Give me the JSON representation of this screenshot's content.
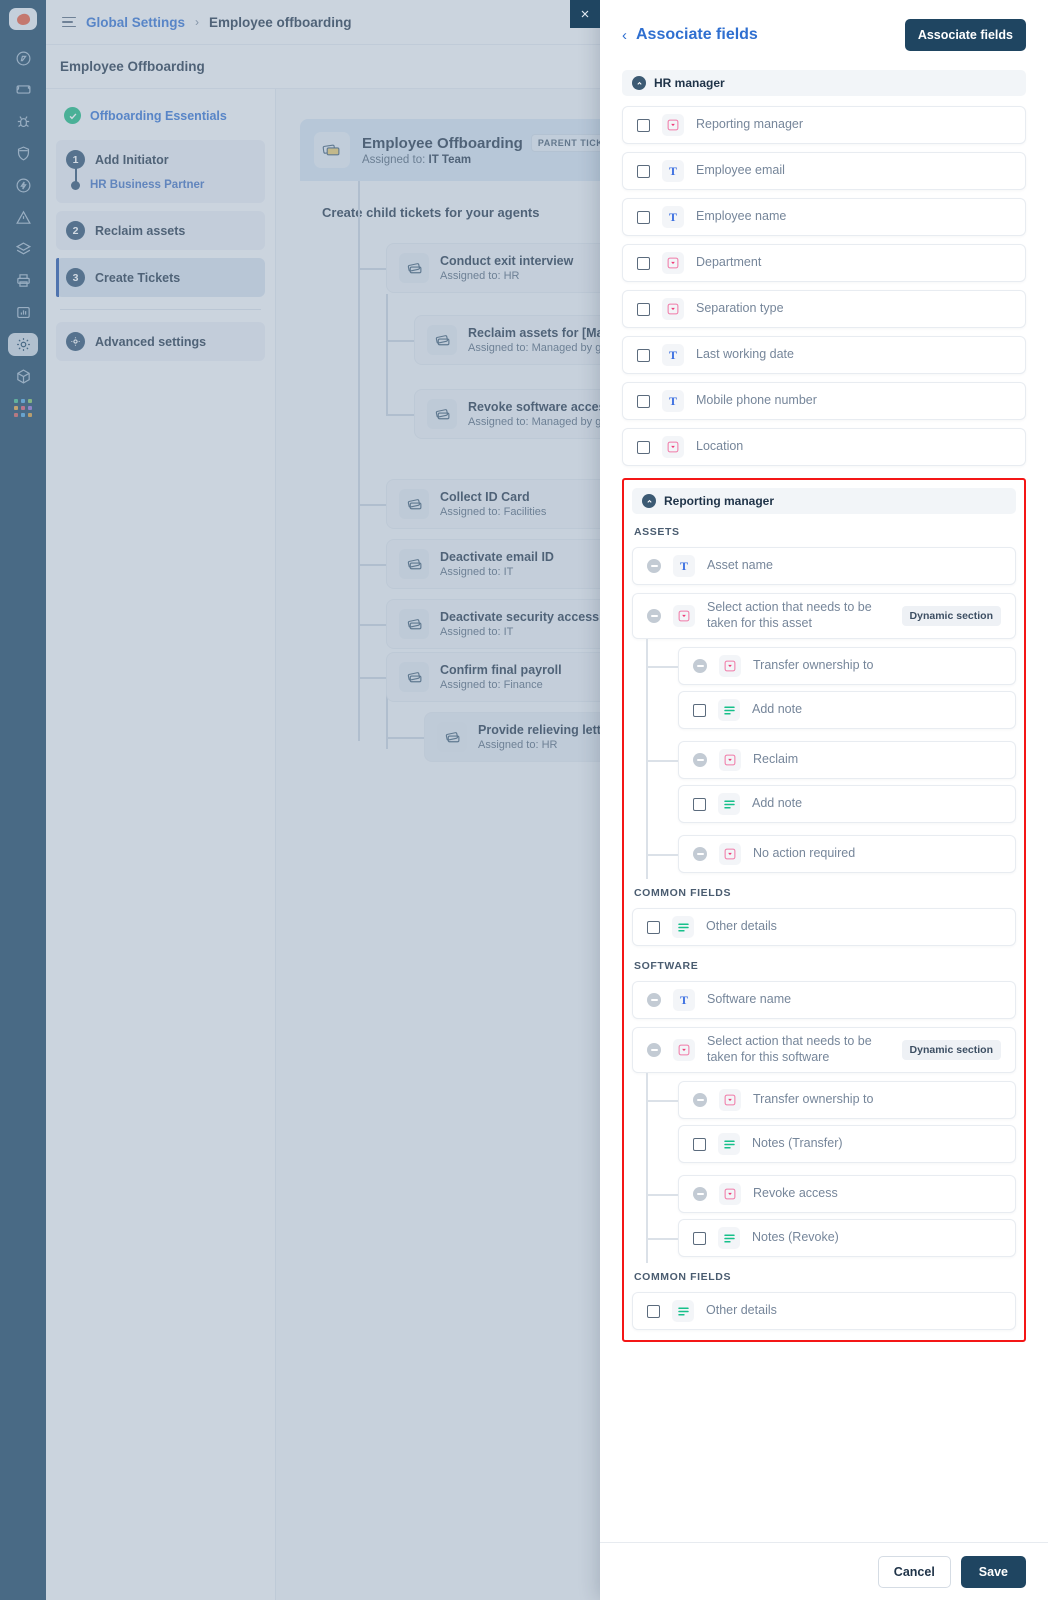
{
  "app": {
    "rail": {
      "logo": "brand-logo",
      "items": [
        {
          "name": "dashboard-icon"
        },
        {
          "name": "ticket-icon"
        },
        {
          "name": "bug-icon"
        },
        {
          "name": "shield-icon"
        },
        {
          "name": "flash-icon"
        },
        {
          "name": "alert-icon"
        },
        {
          "name": "layers-icon"
        },
        {
          "name": "printer-icon"
        },
        {
          "name": "chart-icon"
        },
        {
          "name": "gear-icon",
          "active": true
        },
        {
          "name": "box-icon"
        },
        {
          "name": "apps-grid-icon"
        }
      ]
    },
    "breadcrumb": {
      "root": "Global Settings",
      "separator": "›",
      "current": "Employee offboarding"
    },
    "page_title": "Employee Offboarding",
    "steps": {
      "essentials": "Offboarding Essentials",
      "items": [
        {
          "num": "1",
          "label": "Add Initiator",
          "substep": "HR Business Partner"
        },
        {
          "num": "2",
          "label": "Reclaim assets"
        },
        {
          "num": "3",
          "label": "Create Tickets",
          "active": true
        }
      ],
      "advanced": {
        "num": "⚙",
        "label": "Advanced settings"
      }
    },
    "tree": {
      "parent": {
        "title": "Employee Offboarding",
        "assigned_label": "Assigned to:",
        "assigned_to": "IT Team",
        "badge": "PARENT TICKET"
      },
      "child_heading": "Create child tickets for your agents",
      "children": [
        {
          "title": "Conduct exit interview",
          "assigned": "Assigned to: HR"
        },
        {
          "title": "Reclaim assets for [Manage",
          "assigned": "Assigned to: Managed by gr"
        },
        {
          "title": "Revoke software access for",
          "assigned": "Assigned to: Managed by gr"
        },
        {
          "title": "Collect ID Card",
          "assigned": "Assigned to: Facilities"
        },
        {
          "title": "Deactivate email ID",
          "assigned": "Assigned to: IT"
        },
        {
          "title": "Deactivate security access",
          "assigned": "Assigned to: IT"
        },
        {
          "title": "Confirm final payroll",
          "assigned": "Assigned to: Finance"
        },
        {
          "title": "Provide relieving letter",
          "assigned": "Assigned to: HR"
        }
      ]
    }
  },
  "panel": {
    "close_icon": "close-icon",
    "back_icon": "chevron-left-icon",
    "title": "Associate fields",
    "primary_button": "Associate fields",
    "groups": [
      {
        "id": "hr-manager",
        "title": "HR manager",
        "collapse_icon": "chevron-up-icon",
        "fields": [
          {
            "label": "Reporting manager",
            "type": "dropdown",
            "checkbox": "unchecked"
          },
          {
            "label": "Employee email",
            "type": "text",
            "checkbox": "unchecked"
          },
          {
            "label": "Employee name",
            "type": "text",
            "checkbox": "unchecked"
          },
          {
            "label": "Department",
            "type": "dropdown",
            "checkbox": "unchecked"
          },
          {
            "label": "Separation type",
            "type": "dropdown",
            "checkbox": "unchecked"
          },
          {
            "label": "Last working date",
            "type": "text",
            "checkbox": "unchecked"
          },
          {
            "label": "Mobile phone number",
            "type": "text",
            "checkbox": "unchecked"
          },
          {
            "label": "Location",
            "type": "dropdown",
            "checkbox": "unchecked"
          }
        ]
      }
    ],
    "reporting_manager": {
      "id": "reporting-manager",
      "title": "Reporting manager",
      "collapse_icon": "chevron-up-icon",
      "highlighted": true,
      "highlight_color": "#f41616",
      "sections": [
        {
          "label": "ASSETS",
          "fields": [
            {
              "label": "Asset name",
              "type": "text",
              "checkbox": "disabled"
            },
            {
              "label": "Select action that needs to be taken for this asset",
              "type": "dropdown",
              "checkbox": "disabled",
              "badge": "Dynamic section"
            }
          ],
          "nested": [
            {
              "label": "Transfer ownership to",
              "type": "dropdown",
              "checkbox": "disabled",
              "connector": true
            },
            {
              "label": "Add note",
              "type": "note",
              "checkbox": "unchecked",
              "connector": false
            },
            {
              "label": "Reclaim",
              "type": "dropdown",
              "checkbox": "disabled",
              "connector": true
            },
            {
              "label": "Add note",
              "type": "note",
              "checkbox": "unchecked",
              "connector": false
            },
            {
              "label": "No action required",
              "type": "dropdown",
              "checkbox": "disabled",
              "connector": true
            }
          ]
        },
        {
          "label": "COMMON FIELDS",
          "fields": [
            {
              "label": "Other details",
              "type": "note",
              "checkbox": "unchecked"
            }
          ],
          "nested": []
        },
        {
          "label": "SOFTWARE",
          "fields": [
            {
              "label": "Software name",
              "type": "text",
              "checkbox": "disabled"
            },
            {
              "label": "Select action that needs to be taken for this software",
              "type": "dropdown",
              "checkbox": "disabled",
              "badge": "Dynamic section"
            }
          ],
          "nested": [
            {
              "label": "Transfer ownership to",
              "type": "dropdown",
              "checkbox": "disabled",
              "connector": true
            },
            {
              "label": "Notes (Transfer)",
              "type": "note",
              "checkbox": "unchecked",
              "connector": false
            },
            {
              "label": "Revoke access",
              "type": "dropdown",
              "checkbox": "disabled",
              "connector": true
            },
            {
              "label": "Notes (Revoke)",
              "type": "note",
              "checkbox": "unchecked",
              "connector": true
            }
          ]
        },
        {
          "label": "COMMON FIELDS",
          "fields": [
            {
              "label": "Other details",
              "type": "note",
              "checkbox": "unchecked"
            }
          ],
          "nested": []
        }
      ]
    },
    "footer": {
      "cancel": "Cancel",
      "save": "Save"
    }
  },
  "colors": {
    "accent_blue": "#2f6fd0",
    "navy": "#1f4561",
    "dropdown_pink": "#ef3e7a",
    "text_blue": "#3b6fe0",
    "note_green": "#16c08a",
    "highlight_red": "#f41616",
    "success_green": "#17b97e"
  }
}
